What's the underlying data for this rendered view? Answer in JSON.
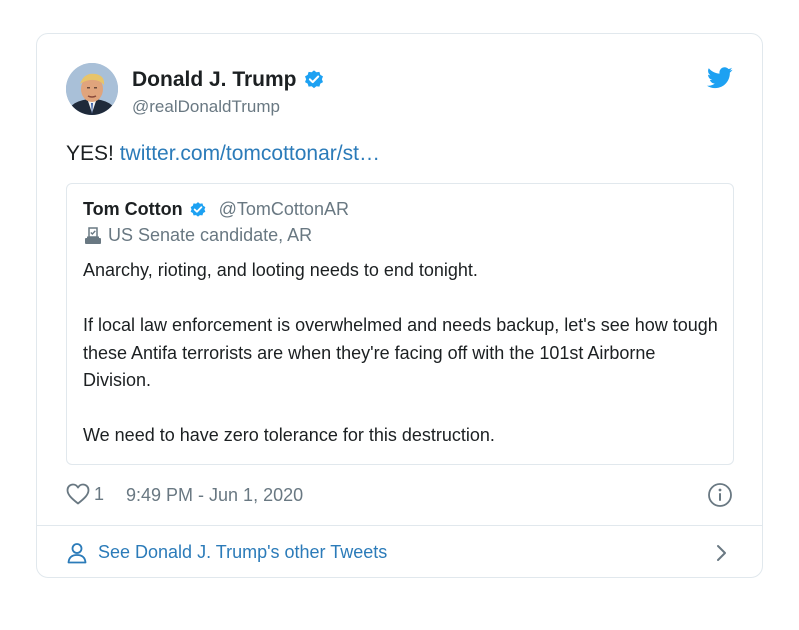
{
  "tweet": {
    "author": {
      "display_name": "Donald J. Trump",
      "handle": "@realDonaldTrump",
      "verified": true
    },
    "text_prefix": "YES! ",
    "link_text": "twitter.com/tomcottonar/st…",
    "quoted_tweet": {
      "author_name": "Tom Cotton",
      "author_handle": "@TomCottonAR",
      "verified": true,
      "label_icon": "ballot-box-icon",
      "label": "US Senate candidate, AR",
      "paragraphs": [
        "Anarchy, rioting, and looting needs to end tonight.",
        "If local law enforcement is overwhelmed and needs backup, let's see how tough these Antifa terrorists are when they're facing off with the 101st Airborne Division.",
        "We need to have zero tolerance for this destruction."
      ]
    },
    "likes": "1",
    "timestamp": "9:49 PM - Jun 1, 2020",
    "footer_link": "See Donald J. Trump's other Tweets"
  },
  "colors": {
    "link": "#2b7bb9",
    "verified": "#1da1f2",
    "twitter_bird": "#1da1f2",
    "secondary_text": "#697882",
    "primary_text": "#1c2022",
    "border": "#e1e8ed"
  },
  "icons": {
    "verified": "verified-badge-icon",
    "brand": "twitter-bird-icon",
    "like": "heart-icon",
    "info": "info-icon",
    "profile": "person-icon",
    "navigate": "chevron-right-icon"
  }
}
